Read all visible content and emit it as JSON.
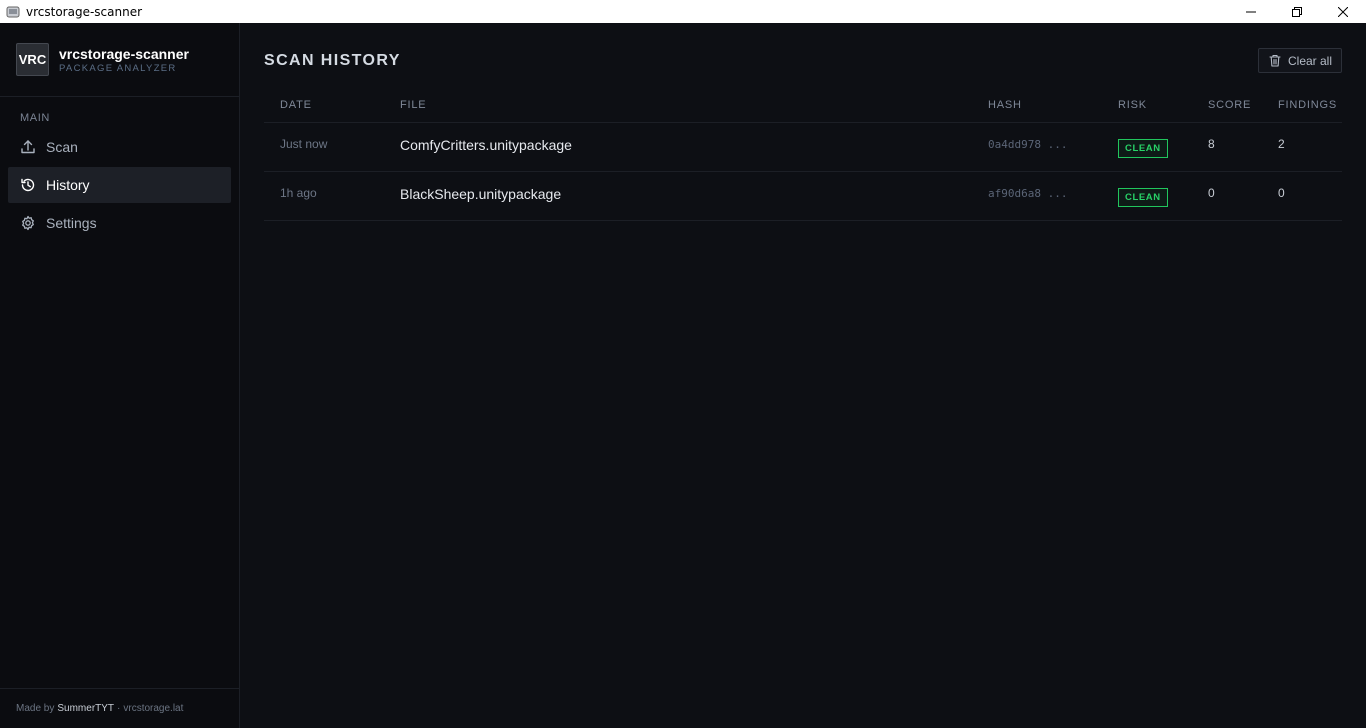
{
  "window": {
    "title": "vrcstorage-scanner",
    "controls": {
      "minimize": "minimize-icon",
      "restore": "restore-icon",
      "close": "close-icon"
    }
  },
  "sidebar": {
    "brand": {
      "logo": "VRC",
      "name": "vrcstorage-scanner",
      "subtitle": "PACKAGE ANALYZER"
    },
    "section_label": "MAIN",
    "items": [
      {
        "label": "Scan",
        "icon": "upload-icon",
        "active": false
      },
      {
        "label": "History",
        "icon": "history-icon",
        "active": true
      },
      {
        "label": "Settings",
        "icon": "gear-icon",
        "active": false
      }
    ],
    "footer": {
      "prefix": "Made by",
      "author": "SummerTYT",
      "separator": "·",
      "site": "vrcstorage.lat"
    }
  },
  "main": {
    "title": "SCAN HISTORY",
    "clear_button": "Clear all",
    "table": {
      "headers": [
        "DATE",
        "FILE",
        "HASH",
        "RISK",
        "SCORE",
        "FINDINGS"
      ],
      "rows": [
        {
          "date": "Just now",
          "file": "ComfyCritters.unitypackage",
          "hash": "0a4dd978 ...",
          "risk": "CLEAN",
          "score": "8",
          "findings": "2"
        },
        {
          "date": "1h ago",
          "file": "BlackSheep.unitypackage",
          "hash": "af90d6a8 ...",
          "risk": "CLEAN",
          "score": "0",
          "findings": "0"
        }
      ]
    }
  },
  "colors": {
    "background": "#0d0f14",
    "sidebar": "#0b0c10",
    "accent_clean": "#21c55d",
    "active_item": "#1d2027"
  }
}
